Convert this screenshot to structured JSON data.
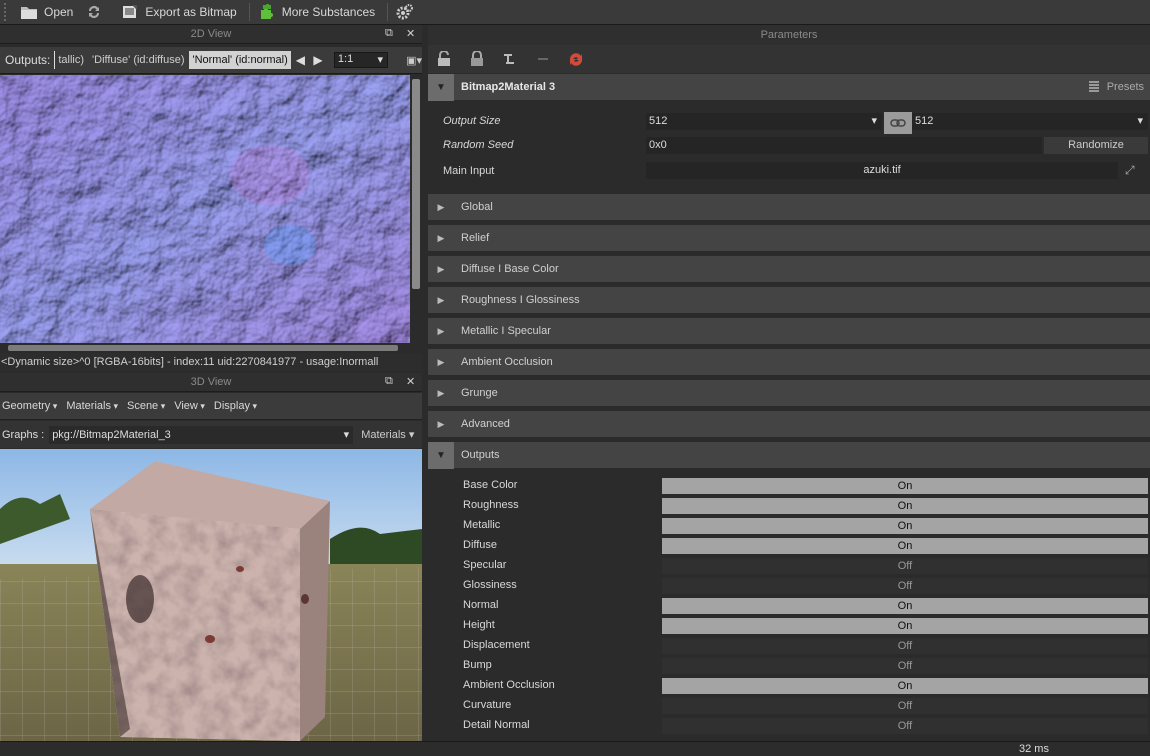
{
  "toolbar": {
    "open_label": "Open",
    "export_label": "Export as Bitmap",
    "more_label": "More Substances"
  },
  "view2d": {
    "title": "2D View",
    "outputs_label": "Outputs:",
    "tabs": [
      {
        "label": "tallic)",
        "selected": false
      },
      {
        "label": "'Diffuse' (id:diffuse)",
        "selected": false
      },
      {
        "label": "'Normal' (id:normal)",
        "selected": true
      }
    ],
    "zoom": "1:1",
    "status": "<Dynamic size>^0 [RGBA-16bits] - index:11 uid:2270841977 - usage:Inormall"
  },
  "view3d": {
    "title": "3D View",
    "menus": [
      "Geometry",
      "Materials",
      "Scene",
      "View",
      "Display"
    ],
    "graphs_label": "Graphs :",
    "graphs_value": "pkg://Bitmap2Material_3",
    "materials_label": "Materials"
  },
  "params": {
    "title": "Parameters",
    "graph_name": "Bitmap2Material 3",
    "presets_label": "Presets",
    "output_size_label": "Output Size",
    "output_size_w": "512",
    "output_size_h": "512",
    "random_seed_label": "Random Seed",
    "random_seed_value": "0x0",
    "randomize_label": "Randomize",
    "main_input_label": "Main Input",
    "main_input_value": "azuki.tif",
    "sections": [
      "Global",
      "Relief",
      "Diffuse I Base Color",
      "Roughness I Glossiness",
      "Metallic I Specular",
      "Ambient Occlusion",
      "Grunge",
      "Advanced"
    ],
    "outputs_section": "Outputs",
    "outputs": [
      {
        "name": "Base Color",
        "state": "On"
      },
      {
        "name": "Roughness",
        "state": "On"
      },
      {
        "name": "Metallic",
        "state": "On"
      },
      {
        "name": "Diffuse",
        "state": "On"
      },
      {
        "name": "Specular",
        "state": "Off"
      },
      {
        "name": "Glossiness",
        "state": "Off"
      },
      {
        "name": "Normal",
        "state": "On"
      },
      {
        "name": "Height",
        "state": "On"
      },
      {
        "name": "Displacement",
        "state": "Off"
      },
      {
        "name": "Bump",
        "state": "Off"
      },
      {
        "name": "Ambient Occlusion",
        "state": "On"
      },
      {
        "name": "Curvature",
        "state": "Off"
      },
      {
        "name": "Detail Normal",
        "state": "Off"
      }
    ]
  },
  "status": {
    "render_time": "32 ms"
  }
}
